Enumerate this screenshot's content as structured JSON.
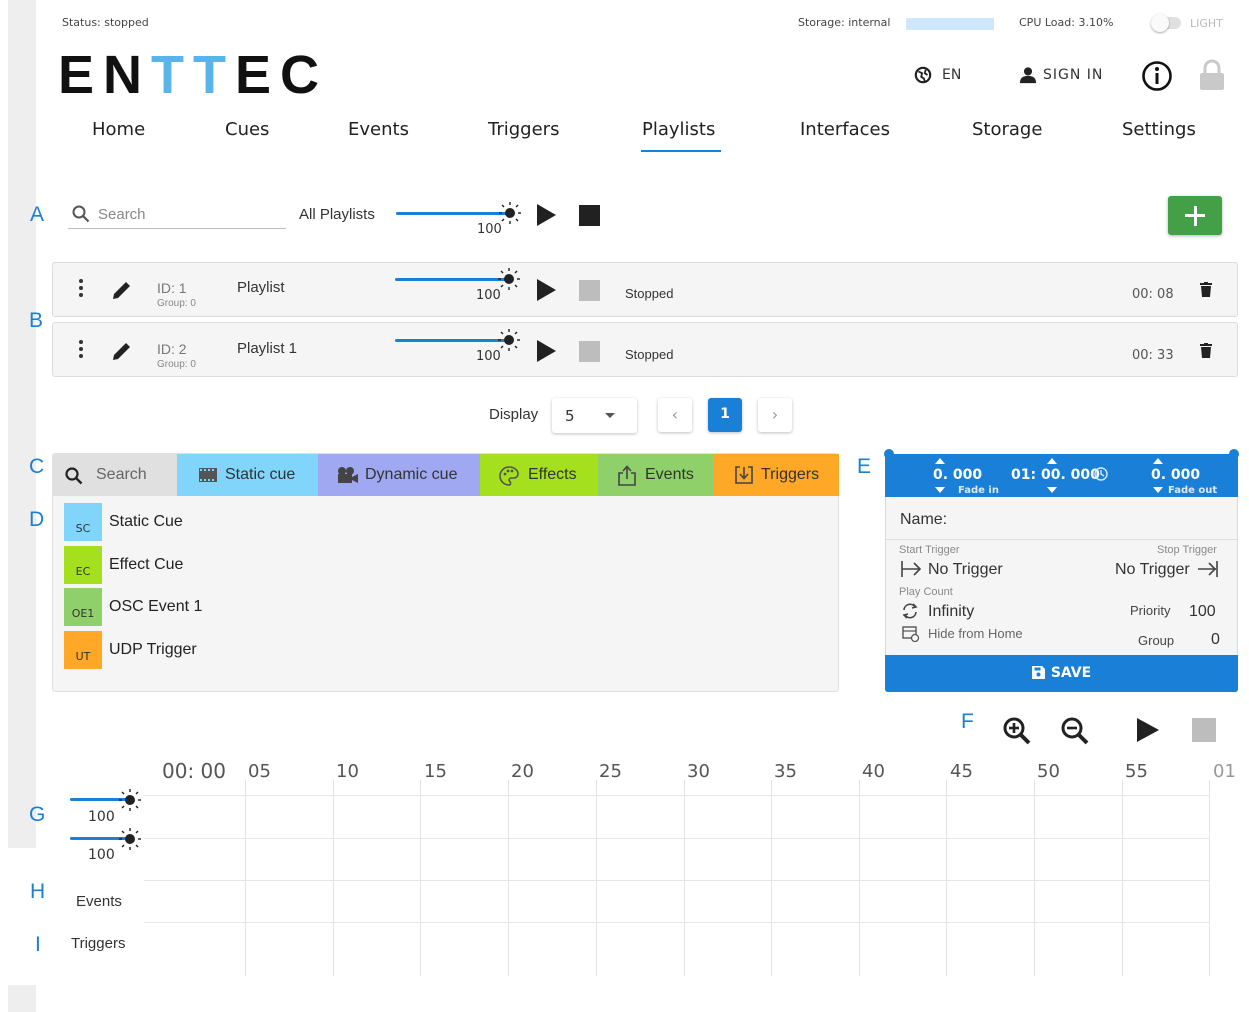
{
  "header": {
    "status_label": "Status: stopped",
    "brand_prefix": "EN",
    "brand_highlight_1": "T",
    "brand_highlight_2": "T",
    "brand_suffix": "EC",
    "storage_label": "Storage: internal",
    "cpu_label": "CPU Load: 3.10%",
    "theme_label": "LIGHT",
    "language_label": "EN",
    "sign_in_label": "SIGN IN",
    "colors": {
      "accent": "#1a7fd6",
      "brand_t": "#5ab4ea",
      "add": "#43a047"
    }
  },
  "nav": {
    "tabs": [
      "Home",
      "Cues",
      "Events",
      "Triggers",
      "Playlists",
      "Interfaces",
      "Storage",
      "Settings"
    ],
    "active": "Playlists"
  },
  "markers": [
    "A",
    "B",
    "C",
    "D",
    "E",
    "F",
    "G",
    "H",
    "I"
  ],
  "toolbar": {
    "search_placeholder": "Search",
    "all_playlists_label": "All Playlists",
    "master_level": "100"
  },
  "playlists": [
    {
      "id": "ID: 1",
      "group": "Group: 0",
      "name": "Playlist",
      "level": "100",
      "status": "Stopped",
      "duration": "00: 08"
    },
    {
      "id": "ID: 2",
      "group": "Group: 0",
      "name": "Playlist 1",
      "level": "100",
      "status": "Stopped",
      "duration": "00: 33"
    }
  ],
  "pagination": {
    "display_label": "Display",
    "page_size": "5",
    "prev": "‹",
    "current_page": "1",
    "next": "›"
  },
  "library": {
    "search_placeholder": "Search",
    "tabs": [
      {
        "label": "Static cue",
        "color": "#81d4fa"
      },
      {
        "label": "Dynamic cue",
        "color": "#9fa8f0"
      },
      {
        "label": "Effects",
        "color": "#a5e01e"
      },
      {
        "label": "Events",
        "color": "#8fd06a"
      },
      {
        "label": "Triggers",
        "color": "#ffa726"
      }
    ],
    "items": [
      {
        "badge": "SC",
        "label": "Static Cue",
        "color": "#81d4fa"
      },
      {
        "badge": "EC",
        "label": "Effect Cue",
        "color": "#a5e01e"
      },
      {
        "badge": "OE1",
        "label": "OSC Event 1",
        "color": "#8fd06a"
      },
      {
        "badge": "UT",
        "label": "UDP Trigger",
        "color": "#ffa726"
      }
    ]
  },
  "cue_editor": {
    "fade_in_value": "0. 000",
    "fade_in_label": "Fade in",
    "duration_value": "01: 00. 000",
    "fade_out_value": "0. 000",
    "fade_out_label": "Fade out",
    "name_label": "Name:",
    "start_trigger_label": "Start Trigger",
    "start_trigger_value": "No Trigger",
    "stop_trigger_label": "Stop Trigger",
    "stop_trigger_value": "No Trigger",
    "play_count_label": "Play Count",
    "play_count_value": "Infinity",
    "priority_label": "Priority",
    "priority_value": "100",
    "hide_label": "Hide from Home",
    "group_label": "Group",
    "group_value": "0",
    "save_label": "SAVE"
  },
  "timeline": {
    "start_label": "00: 00",
    "ticks": [
      "05",
      "10",
      "15",
      "20",
      "25",
      "30",
      "35",
      "40",
      "45",
      "50",
      "55",
      "01"
    ],
    "track_levels": [
      "100",
      "100"
    ],
    "events_label": "Events",
    "triggers_label": "Triggers"
  }
}
